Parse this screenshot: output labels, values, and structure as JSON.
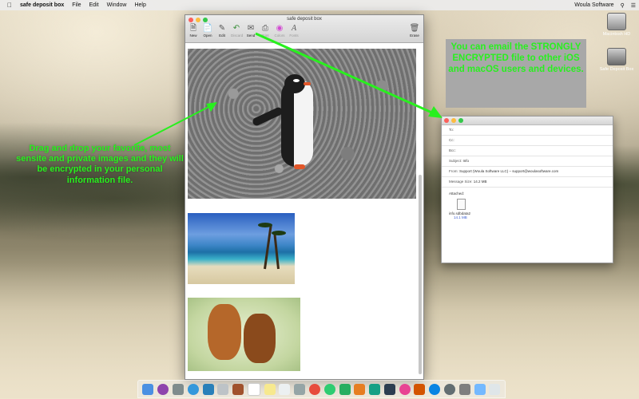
{
  "menubar": {
    "app_name": "safe deposit box",
    "items": [
      "File",
      "Edit",
      "Window",
      "Help"
    ],
    "right_text": "Woula Software"
  },
  "desktop": {
    "icons": [
      {
        "label": "Macintosh HD",
        "icon": "hard-drive-icon"
      },
      {
        "label": "Safe Deposit Box",
        "icon": "safe-icon"
      }
    ]
  },
  "window": {
    "title": "safe deposit box",
    "toolbar": [
      {
        "label": "New",
        "icon": "new-doc-icon",
        "enabled": true
      },
      {
        "label": "Open",
        "icon": "open-icon",
        "enabled": true
      },
      {
        "label": "Edit",
        "icon": "pen-icon",
        "enabled": true
      },
      {
        "label": "Discard",
        "icon": "undo-arrow-icon",
        "enabled": false
      },
      {
        "label": "Send",
        "icon": "send-icon",
        "enabled": true
      },
      {
        "label": "Print",
        "icon": "printer-icon",
        "enabled": false
      },
      {
        "label": "Colors",
        "icon": "color-wheel-icon",
        "enabled": false
      },
      {
        "label": "Fonts",
        "icon": "font-icon",
        "enabled": false
      }
    ],
    "erase_label": "Erase"
  },
  "mail": {
    "to_label": "To:",
    "cc_label": "Cc:",
    "bcc_label": "Bcc:",
    "subject_label": "Subject:",
    "subject_value": "Info",
    "from_label": "From:",
    "from_value": "Support (Woula Software LLC) – support@woulasoftware.com",
    "size_label": "Message Size:",
    "size_value": "14.2 MB",
    "attached_label": "Attached:",
    "attachment_name": "info.sdbdata2",
    "attachment_size": "14.1 MB"
  },
  "callouts": {
    "right": "You can email the STRONGLY ENCRYPTED file to other iOS and macOS users and devices.",
    "left": "Drag and drop your favorite, most sensite and private images and they will be encrypted in your personal information file."
  },
  "colors": {
    "callout_text": "#28f01e",
    "callout_box": "#a8a8a8"
  }
}
